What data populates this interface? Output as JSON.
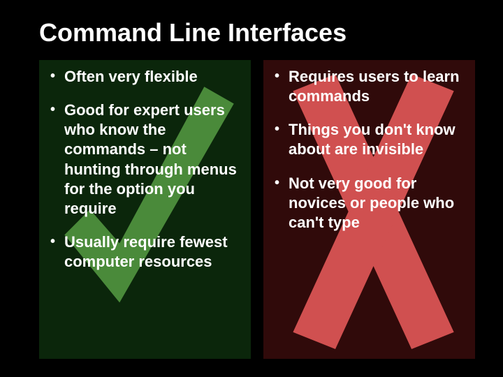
{
  "title": "Command Line Interfaces",
  "colors": {
    "background": "#000000",
    "text": "#ffffff",
    "prosPanel": "#0b260b",
    "consPanel": "#300a0a",
    "checkIcon": "#4a8a3a",
    "crossIcon": "#d05050"
  },
  "icons": {
    "pros": "check-icon",
    "cons": "cross-icon"
  },
  "pros": {
    "items": [
      {
        "text": "Often very flexible"
      },
      {
        "text": "Good for expert users who know the commands – not hunting through menus for the option you require"
      },
      {
        "text": "Usually require fewest computer resources"
      }
    ]
  },
  "cons": {
    "items": [
      {
        "text": "Requires users to learn commands"
      },
      {
        "text": "Things you don't know about are invisible"
      },
      {
        "text": "Not very good for novices or people who can't type"
      }
    ]
  },
  "bullet": "•"
}
